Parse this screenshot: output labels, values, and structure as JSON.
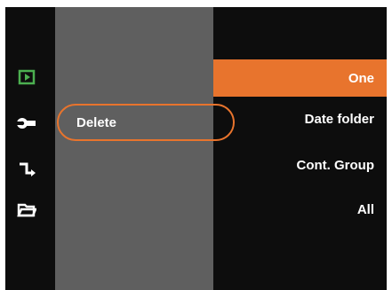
{
  "colors": {
    "accent": "#e8742d",
    "background": "#0d0d0d",
    "panel": "#5f5f5f",
    "playback_icon": "#4caf50",
    "text": "#ffffff"
  },
  "sidebar": {
    "icons": [
      {
        "name": "playback-icon",
        "active": true
      },
      {
        "name": "wrench-icon"
      },
      {
        "name": "connection-icon"
      },
      {
        "name": "folder-icon"
      }
    ]
  },
  "menu": {
    "selected_item": "Delete"
  },
  "submenu": {
    "options": [
      "One",
      "Date folder",
      "Cont. Group",
      "All"
    ],
    "selected_index": 0
  }
}
